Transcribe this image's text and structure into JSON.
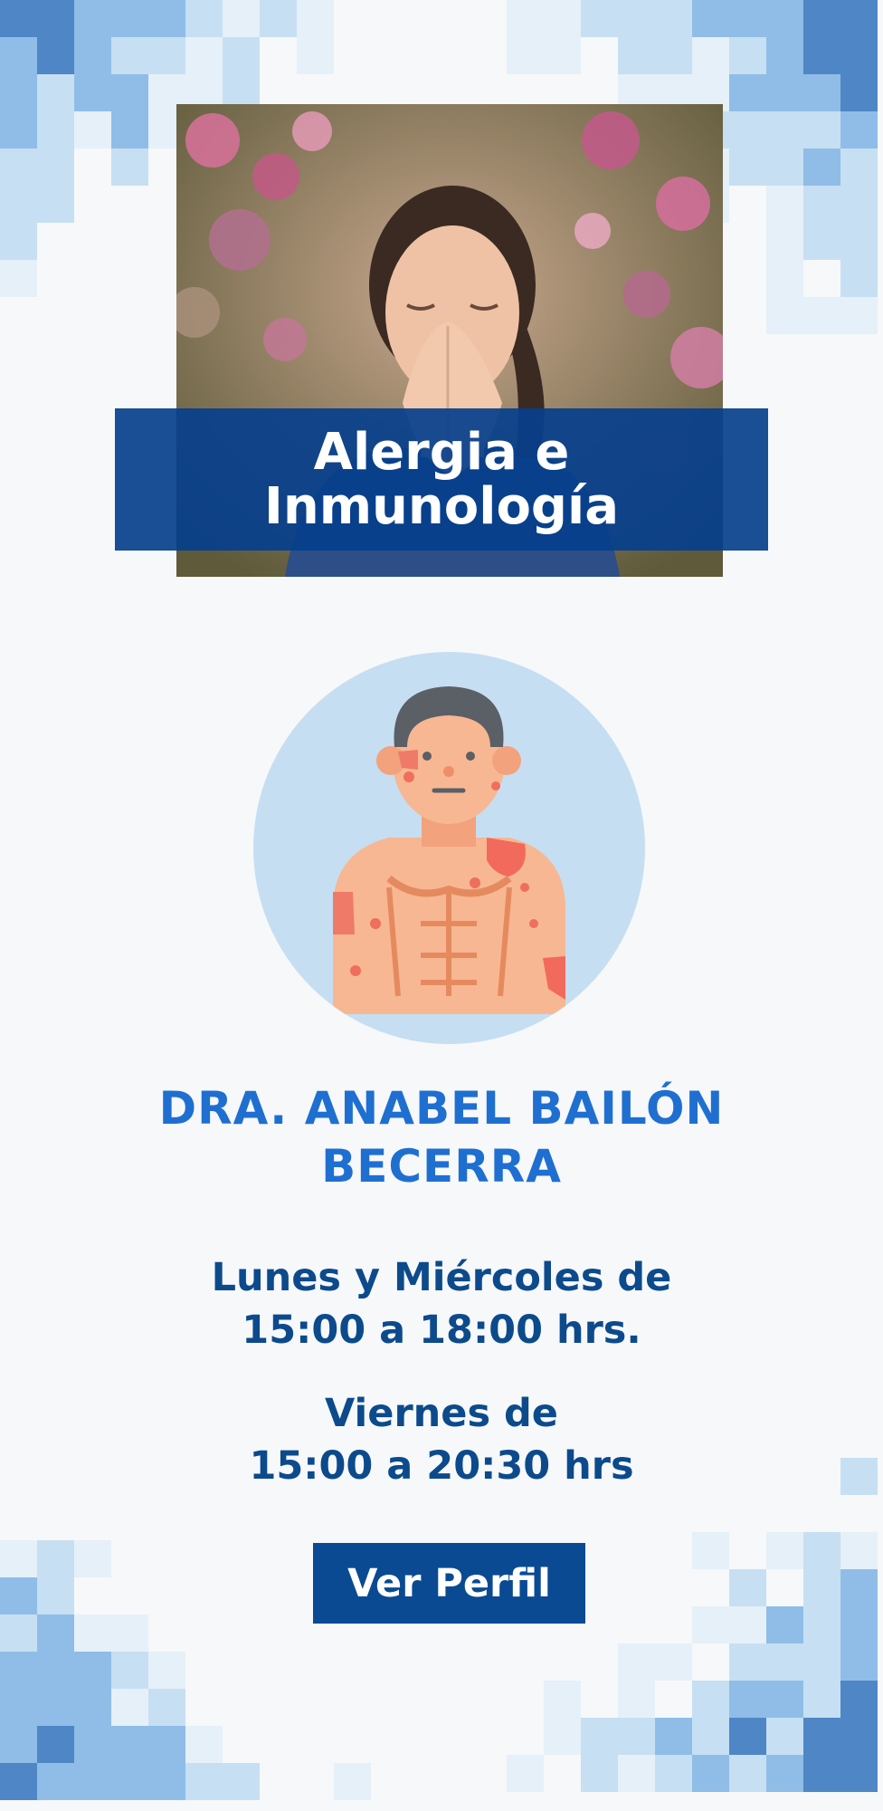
{
  "specialty": {
    "line1": "Alergia e",
    "line2": "Inmunología"
  },
  "doctor": {
    "name_line1": "DRA. ANABEL BAILÓN",
    "name_line2": "BECERRA"
  },
  "schedule": {
    "block1": {
      "line1": "Lunes y Miércoles de",
      "line2": "15:00 a 18:00 hrs."
    },
    "block2": {
      "line1": "Viernes de",
      "line2": "15:00 a 20:30 hrs"
    }
  },
  "cta": {
    "label": "Ver Perfil"
  },
  "icons": {
    "photo": "woman-sneezing-photo",
    "avatar": "man-skin-rash-icon"
  },
  "colors": {
    "banner": "#063f8c",
    "name": "#1f6fd1",
    "schedule": "#0c4a8c",
    "button": "#0a4a92",
    "mosaic": [
      "#4f86c6",
      "#8fbde8",
      "#c7dff2",
      "#e6f0f8"
    ]
  }
}
